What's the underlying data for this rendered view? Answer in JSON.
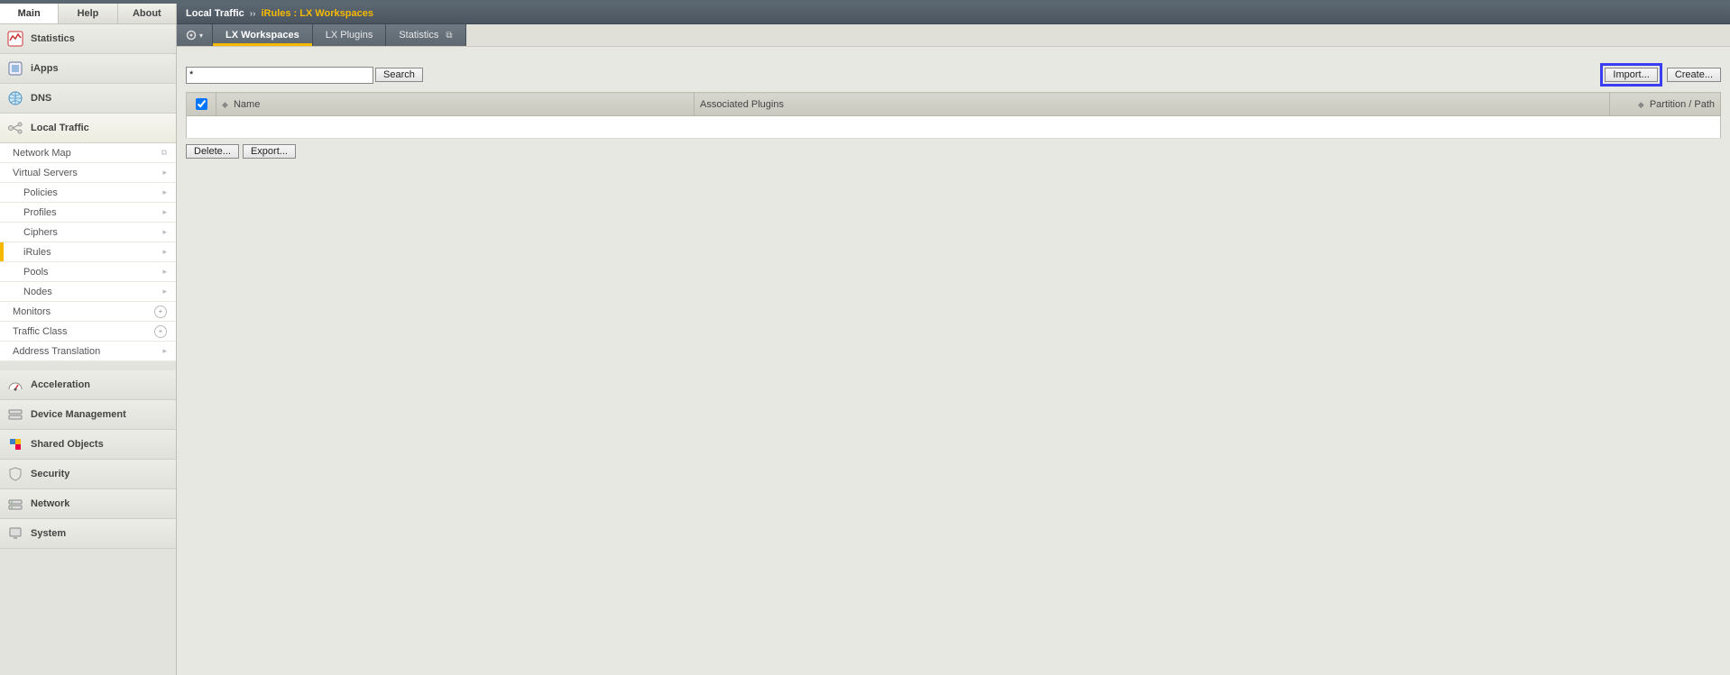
{
  "topTabs": {
    "main": "Main",
    "help": "Help",
    "about": "About"
  },
  "sidebar": {
    "sections": {
      "statistics": "Statistics",
      "iapps": "iApps",
      "dns": "DNS",
      "local_traffic": "Local Traffic",
      "acceleration": "Acceleration",
      "device_management": "Device Management",
      "shared_objects": "Shared Objects",
      "security": "Security",
      "network": "Network",
      "system": "System"
    },
    "local_traffic_items": {
      "network_map": "Network Map",
      "virtual_servers": "Virtual Servers",
      "policies": "Policies",
      "profiles": "Profiles",
      "ciphers": "Ciphers",
      "irules": "iRules",
      "pools": "Pools",
      "nodes": "Nodes",
      "monitors": "Monitors",
      "traffic_class": "Traffic Class",
      "address_translation": "Address Translation"
    }
  },
  "breadcrumb": {
    "root": "Local Traffic",
    "sep": "››",
    "current": "iRules : LX Workspaces"
  },
  "tabs": {
    "lx_workspaces": "LX Workspaces",
    "lx_plugins": "LX Plugins",
    "statistics": "Statistics"
  },
  "search": {
    "value": "*",
    "button": "Search"
  },
  "buttons": {
    "import": "Import...",
    "create": "Create...",
    "delete": "Delete...",
    "export": "Export..."
  },
  "table": {
    "col_name": "Name",
    "col_plugins": "Associated Plugins",
    "col_partition": "Partition / Path"
  }
}
